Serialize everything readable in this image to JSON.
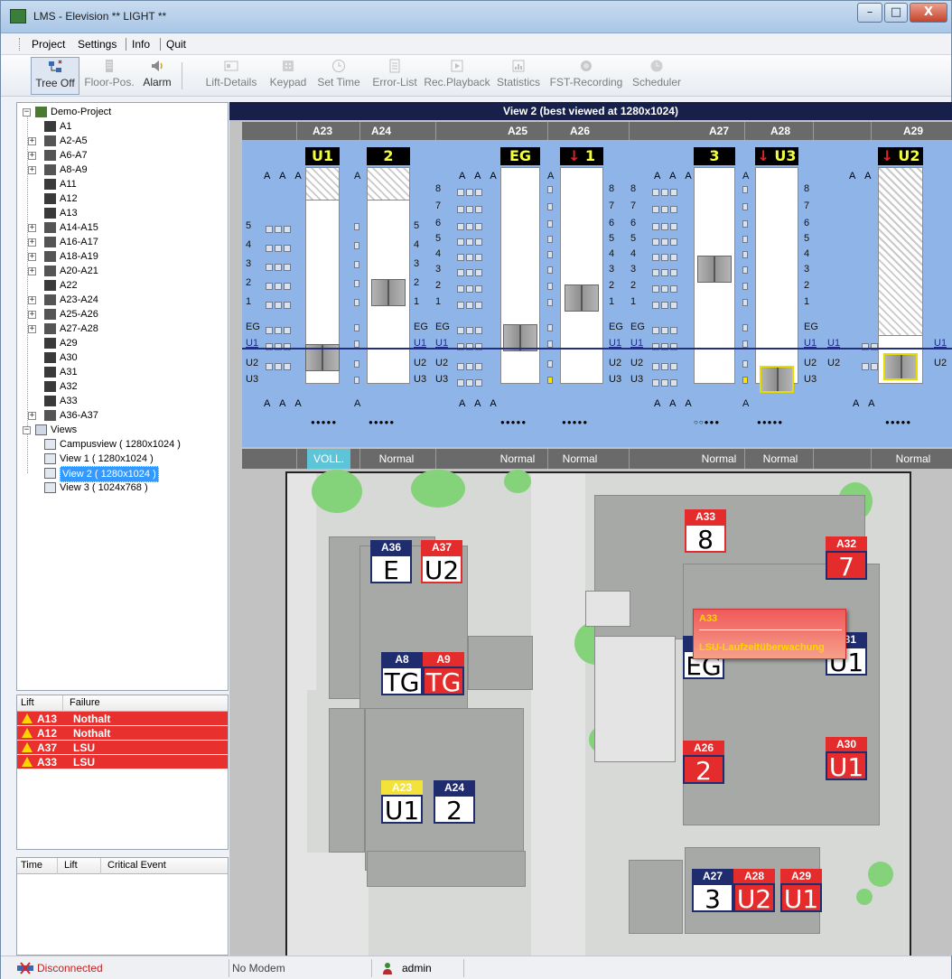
{
  "window": {
    "title": "LMS - Elevision ** LIGHT **",
    "minimize": "–",
    "maximize": "□",
    "close": "X"
  },
  "menu": [
    {
      "label": "Project"
    },
    {
      "label": "Settings"
    },
    {
      "label": "Info"
    },
    {
      "label": "Quit"
    }
  ],
  "toolbar": [
    {
      "label": "Tree Off",
      "icon": "tree-icon",
      "enabled": true
    },
    {
      "label": "Floor-Pos.",
      "icon": "floor-pos-icon",
      "enabled": false
    },
    {
      "label": "Alarm",
      "icon": "alarm-icon",
      "enabled": true
    },
    {
      "label": "Lift-Details",
      "icon": "lift-details-icon",
      "enabled": false
    },
    {
      "label": "Keypad",
      "icon": "keypad-icon",
      "enabled": false
    },
    {
      "label": "Set Time",
      "icon": "clock-icon",
      "enabled": false
    },
    {
      "label": "Error-List",
      "icon": "error-list-icon",
      "enabled": false
    },
    {
      "label": "Rec.Playback",
      "icon": "playback-icon",
      "enabled": false
    },
    {
      "label": "Statistics",
      "icon": "statistics-icon",
      "enabled": false
    },
    {
      "label": "FST-Recording",
      "icon": "record-icon",
      "enabled": false
    },
    {
      "label": "Scheduler",
      "icon": "scheduler-icon",
      "enabled": false
    }
  ],
  "tree": {
    "root": "Demo-Project",
    "items": [
      "A1",
      "A2-A5",
      "A6-A7",
      "A8-A9",
      "A11",
      "A12",
      "A13",
      "A14-A15",
      "A16-A17",
      "A18-A19",
      "A20-A21",
      "A22",
      "A23-A24",
      "A25-A26",
      "A27-A28",
      "A29",
      "A30",
      "A31",
      "A32",
      "A33",
      "A36-A37"
    ],
    "views_root": "Views",
    "views": [
      "Campusview ( 1280x1024 )",
      "View 1 ( 1280x1024 )",
      "View 2 ( 1280x1024 )",
      "View 3 ( 1024x768 )"
    ],
    "selected_view": "View 2 ( 1280x1024 )"
  },
  "failures": {
    "headers": {
      "lift": "Lift",
      "failure": "Failure"
    },
    "rows": [
      {
        "lift": "A13",
        "failure": "Nothalt"
      },
      {
        "lift": "A12",
        "failure": "Nothalt"
      },
      {
        "lift": "A37",
        "failure": "LSU"
      },
      {
        "lift": "A33",
        "failure": "LSU"
      }
    ]
  },
  "events": {
    "headers": {
      "time": "Time",
      "lift": "Lift",
      "event": "Critical Event"
    }
  },
  "status": {
    "connection": "Disconnected",
    "modem": "No Modem",
    "user": "admin"
  },
  "view": {
    "title": "View 2 (best viewed at 1280x1024)",
    "lift_headers": [
      "A23",
      "A24",
      "A25",
      "A26",
      "A27",
      "A28",
      "A29"
    ],
    "lift_displays": [
      "U1",
      "2",
      "EG",
      "1",
      "3",
      "U3",
      "U2"
    ],
    "lift_status": [
      "VOLL.",
      "Normal",
      "Normal",
      "Normal",
      "Normal",
      "Normal",
      "Normal"
    ],
    "door_marks": "A A A",
    "door_mark_single": "A",
    "door_mark_pair": "A A",
    "dots_full": "●●●●●",
    "dots_partial": "○○●●●",
    "floors_a": [
      "5",
      "4",
      "3",
      "2",
      "1",
      "EG",
      "U1",
      "U2",
      "U3"
    ],
    "floors_b": [
      "8",
      "7",
      "6",
      "5",
      "4",
      "3",
      "2",
      "1",
      "EG",
      "U1",
      "U2",
      "U3"
    ],
    "floors_c": [
      "U1",
      "U2"
    ]
  },
  "map": {
    "markers": [
      {
        "lift": "A36",
        "value": "E"
      },
      {
        "lift": "A37",
        "value": "U2"
      },
      {
        "lift": "A8",
        "value": "TG"
      },
      {
        "lift": "A9",
        "value": "TG"
      },
      {
        "lift": "A23",
        "value": "U1"
      },
      {
        "lift": "A24",
        "value": "2"
      },
      {
        "lift": "A33",
        "value": "8"
      },
      {
        "lift": "A32",
        "value": "7"
      },
      {
        "lift": "A25",
        "value": "EG"
      },
      {
        "lift": "A31",
        "value": "U1"
      },
      {
        "lift": "A26",
        "value": "2"
      },
      {
        "lift": "A30",
        "value": "U1"
      },
      {
        "lift": "A27",
        "value": "3"
      },
      {
        "lift": "A28",
        "value": "U2"
      },
      {
        "lift": "A29",
        "value": "U1"
      }
    ],
    "tooltip": {
      "title": "A33",
      "text": "LSU-Laufzeitüberwachung"
    }
  }
}
